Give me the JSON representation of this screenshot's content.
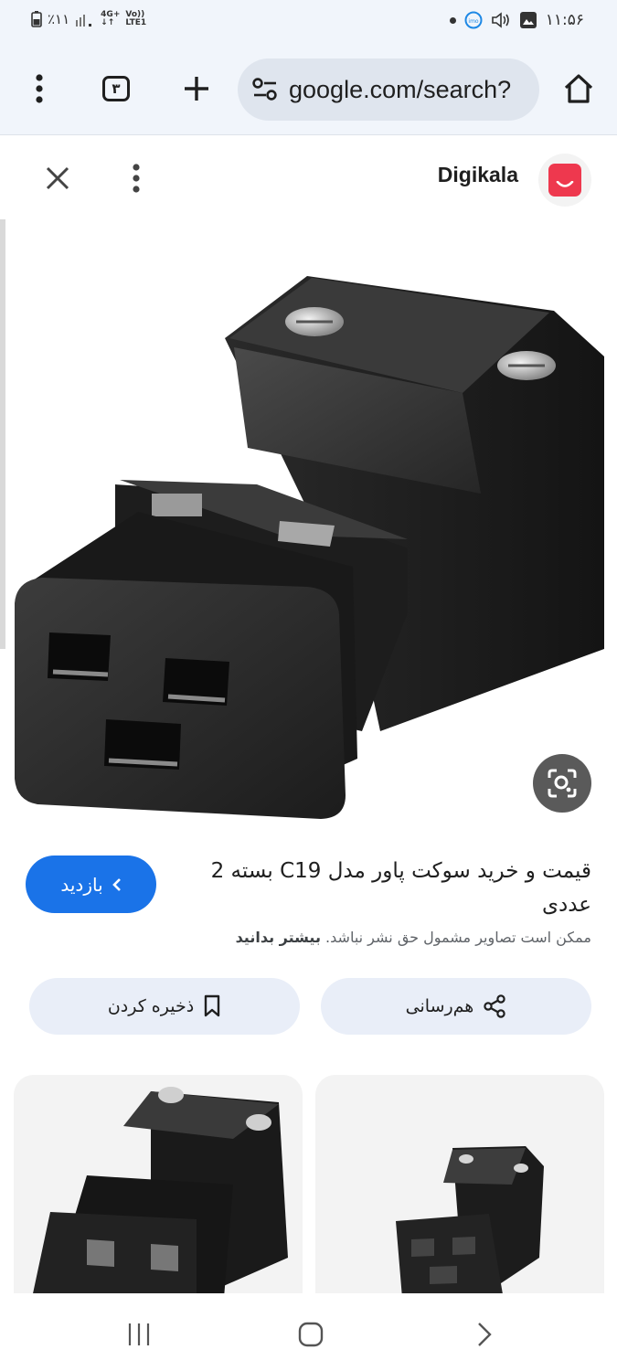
{
  "status_bar": {
    "battery": "٪۱۱",
    "network_top": "4G+",
    "network_bottom": "↓↑",
    "volte_top": "Vo))",
    "volte_bottom": "LTE1",
    "time": "۱۱:۵۶"
  },
  "toolbar": {
    "tab_count": "۳",
    "url": "google.com/search?"
  },
  "preview": {
    "site_name": "Digikala",
    "title_line": "قیمت و خرید سوکت پاور مدل C19 بسته 2 عددی",
    "copyright_text": "ممکن است تصاویر مشمول حق نشر نباشد.",
    "learn_more": "بیشتر بدانید",
    "visit_label": "بازدید",
    "share_label": "هم‌رسانی",
    "save_label": "ذخیره کردن"
  },
  "colors": {
    "accent_blue": "#1a73e8",
    "digikala_red": "#ee384e",
    "chip_bg": "#e9eef8",
    "toolbar_bg": "#f1f5fb"
  },
  "icons": {
    "menu": "vertical-dots-icon",
    "new_tab": "plus-icon",
    "home": "home-icon",
    "site_settings": "tune-icon",
    "close": "close-icon",
    "lens": "lens-icon",
    "share": "share-icon",
    "bookmark": "bookmark-icon",
    "visit": "chevron-left-icon"
  }
}
